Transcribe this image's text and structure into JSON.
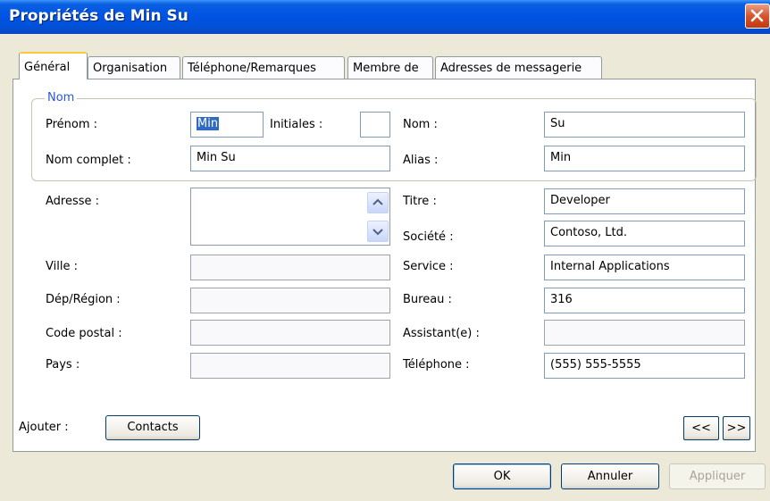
{
  "window": {
    "title": "Propriétés de Min Su"
  },
  "tabs": [
    {
      "label": "Général"
    },
    {
      "label": "Organisation"
    },
    {
      "label": "Téléphone/Remarques"
    },
    {
      "label": "Membre de"
    },
    {
      "label": "Adresses de messagerie"
    }
  ],
  "group": {
    "legend": "Nom"
  },
  "fields": {
    "prenom": {
      "label": "Prénom :",
      "value": "Min"
    },
    "initiales": {
      "label": "Initiales :",
      "value": ""
    },
    "nom": {
      "label": "Nom :",
      "value": "Su"
    },
    "nom_complet": {
      "label": "Nom complet :",
      "value": "Min Su"
    },
    "alias": {
      "label": "Alias :",
      "value": "Min"
    },
    "adresse": {
      "label": "Adresse :",
      "value": ""
    },
    "titre": {
      "label": "Titre :",
      "value": "Developer"
    },
    "societe": {
      "label": "Société :",
      "value": "Contoso, Ltd."
    },
    "ville": {
      "label": "Ville :",
      "value": ""
    },
    "service": {
      "label": "Service :",
      "value": "Internal Applications"
    },
    "dep_region": {
      "label": "Dép/Région :",
      "value": ""
    },
    "bureau": {
      "label": "Bureau :",
      "value": "316"
    },
    "code_postal": {
      "label": "Code postal :",
      "value": ""
    },
    "assistant": {
      "label": "Assistant(e) :",
      "value": ""
    },
    "pays": {
      "label": "Pays :",
      "value": ""
    },
    "telephone": {
      "label": "Téléphone :",
      "value": "(555) 555-5555"
    }
  },
  "ajouter": {
    "label": "Ajouter :",
    "contacts_button": "Contacts"
  },
  "nav": {
    "prev": "<<",
    "next": ">>"
  },
  "buttons": {
    "ok": "OK",
    "cancel": "Annuler",
    "apply": "Appliquer"
  },
  "colors": {
    "title_bar": "#0054e3",
    "selection": "#316ac5",
    "legend": "#2a57d9"
  },
  "icons": {
    "close": "close-icon",
    "scroll_up": "scroll-up-arrow-icon",
    "scroll_down": "scroll-down-arrow-icon"
  }
}
